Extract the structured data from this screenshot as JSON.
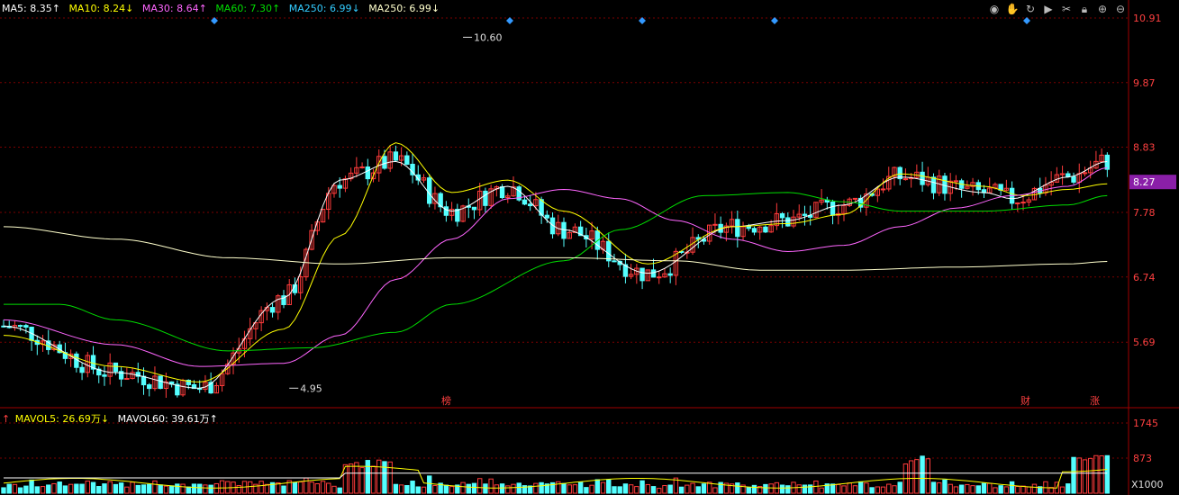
{
  "legend": {
    "items": [
      {
        "label": "MA5: 8.35↑",
        "color": "#ffffff"
      },
      {
        "label": "MA10: 8.24↓",
        "color": "#ffff00"
      },
      {
        "label": "MA30: 8.64↑",
        "color": "#ff66ff"
      },
      {
        "label": "MA60: 7.30↑",
        "color": "#00dd00"
      },
      {
        "label": "MA250: 6.99↓",
        "color": "#33ccff"
      },
      {
        "label": "MA250: 6.99↓",
        "color": "#ffffcc"
      }
    ]
  },
  "vol_legend": {
    "lead": "↑",
    "items": [
      {
        "label": "MAVOL5: 26.69万↓",
        "color": "#ffff00"
      },
      {
        "label": "MAVOL60: 39.61万↑",
        "color": "#ffffff"
      }
    ]
  },
  "toolbar": [
    "eye-icon",
    "hand-icon",
    "refresh-icon",
    "play-icon",
    "scissors-icon",
    "lock-icon",
    "zoom-in-icon",
    "zoom-out-icon"
  ],
  "colors": {
    "up": "#ff3b3b",
    "down": "#54ffff",
    "grid": "#7a0000",
    "axis": "#a00000",
    "label": "#ff4040"
  },
  "markers": {
    "high_label": "10.60",
    "low_label": "4.95",
    "events": [
      "榜",
      "财",
      "涨"
    ]
  },
  "current_price": "8.27",
  "chart_data": {
    "type": "candlestick",
    "price_axis": {
      "ticks": [
        "10.91",
        "9.87",
        "8.83",
        "7.78",
        "6.74",
        "5.69"
      ],
      "ylim": [
        4.65,
        10.91
      ]
    },
    "volume_axis": {
      "ticks": [
        "1745",
        "873"
      ],
      "unit": "X1000",
      "ylim": [
        0,
        1745
      ]
    },
    "series": [
      {
        "name": "MA5",
        "color": "#ffffff",
        "anchors": [
          [
            0,
            5.95
          ],
          [
            20,
            5.2
          ],
          [
            35,
            4.95
          ],
          [
            50,
            6.4
          ],
          [
            60,
            8.3
          ],
          [
            70,
            8.6
          ],
          [
            80,
            7.8
          ],
          [
            90,
            8.2
          ],
          [
            100,
            7.5
          ],
          [
            115,
            6.8
          ],
          [
            130,
            7.55
          ],
          [
            140,
            7.65
          ],
          [
            150,
            7.9
          ],
          [
            160,
            8.35
          ],
          [
            175,
            8.1
          ],
          [
            180,
            8.0
          ],
          [
            190,
            8.35
          ],
          [
            197,
            8.6
          ]
        ]
      },
      {
        "name": "MA10",
        "color": "#ffff00",
        "anchors": [
          [
            0,
            5.8
          ],
          [
            20,
            5.3
          ],
          [
            35,
            5.05
          ],
          [
            50,
            5.9
          ],
          [
            60,
            7.4
          ],
          [
            70,
            8.9
          ],
          [
            80,
            8.1
          ],
          [
            90,
            8.3
          ],
          [
            100,
            7.8
          ],
          [
            115,
            6.95
          ],
          [
            130,
            7.55
          ],
          [
            140,
            7.6
          ],
          [
            150,
            7.75
          ],
          [
            160,
            8.4
          ],
          [
            175,
            8.2
          ],
          [
            182,
            8.05
          ],
          [
            190,
            8.15
          ],
          [
            197,
            8.24
          ]
        ]
      },
      {
        "name": "MA30",
        "color": "#ff66ff",
        "anchors": [
          [
            0,
            6.05
          ],
          [
            20,
            5.65
          ],
          [
            35,
            5.3
          ],
          [
            50,
            5.35
          ],
          [
            60,
            5.8
          ],
          [
            70,
            6.7
          ],
          [
            80,
            7.35
          ],
          [
            90,
            8.0
          ],
          [
            100,
            8.15
          ],
          [
            110,
            8.0
          ],
          [
            120,
            7.65
          ],
          [
            130,
            7.35
          ],
          [
            140,
            7.15
          ],
          [
            150,
            7.25
          ],
          [
            160,
            7.55
          ],
          [
            170,
            7.85
          ],
          [
            180,
            8.05
          ],
          [
            190,
            8.2
          ],
          [
            197,
            8.5
          ]
        ]
      },
      {
        "name": "MA60",
        "color": "#00dd00",
        "anchors": [
          [
            0,
            6.3
          ],
          [
            10,
            6.3
          ],
          [
            20,
            6.05
          ],
          [
            40,
            5.55
          ],
          [
            55,
            5.6
          ],
          [
            70,
            5.85
          ],
          [
            80,
            6.3
          ],
          [
            100,
            7.0
          ],
          [
            110,
            7.5
          ],
          [
            125,
            8.05
          ],
          [
            140,
            8.1
          ],
          [
            150,
            7.95
          ],
          [
            160,
            7.8
          ],
          [
            175,
            7.8
          ],
          [
            190,
            7.9
          ],
          [
            197,
            8.05
          ]
        ]
      },
      {
        "name": "MA250",
        "color": "#ffffcc",
        "anchors": [
          [
            0,
            7.55
          ],
          [
            20,
            7.35
          ],
          [
            40,
            7.05
          ],
          [
            60,
            6.95
          ],
          [
            80,
            7.05
          ],
          [
            100,
            7.05
          ],
          [
            120,
            7.0
          ],
          [
            135,
            6.85
          ],
          [
            150,
            6.85
          ],
          [
            170,
            6.9
          ],
          [
            190,
            6.95
          ],
          [
            197,
            6.99
          ]
        ]
      }
    ]
  }
}
